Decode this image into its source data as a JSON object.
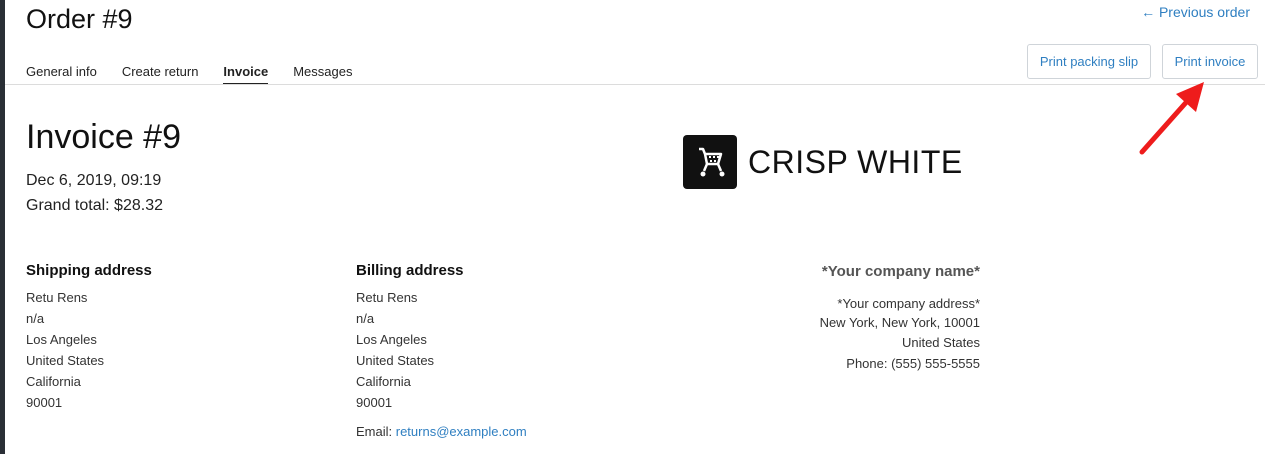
{
  "header": {
    "order_title": "Order #9",
    "prev_link": "← Previous order"
  },
  "tabs": [
    {
      "label": "General info"
    },
    {
      "label": "Create return"
    },
    {
      "label": "Invoice",
      "active": true
    },
    {
      "label": "Messages"
    }
  ],
  "actions": {
    "print_slip": "Print packing slip",
    "print_invoice": "Print invoice"
  },
  "invoice": {
    "title": "Invoice #9",
    "date": "Dec 6, 2019, 09:19",
    "grand_total": "Grand total: $28.32"
  },
  "brand": {
    "name": "CRISP WHITE",
    "logo_icon": "cart-icon"
  },
  "shipping": {
    "heading": "Shipping address",
    "lines": [
      "Retu  Rens",
      "n/a",
      "Los Angeles",
      "United States",
      "California",
      "90001"
    ]
  },
  "billing": {
    "heading": "Billing address",
    "lines": [
      "Retu  Rens",
      "n/a",
      "Los Angeles",
      "United States",
      "California",
      "90001"
    ],
    "email_label": "Email: ",
    "email": "returns@example.com"
  },
  "company": {
    "name": "*Your company name*",
    "address": "*Your company address*",
    "city": "New York, New York, 10001",
    "country": "United States",
    "phone": "Phone: (555) 555-5555"
  },
  "colors": {
    "link": "#2f7fc1",
    "annotation_arrow": "#ee1c1c"
  }
}
